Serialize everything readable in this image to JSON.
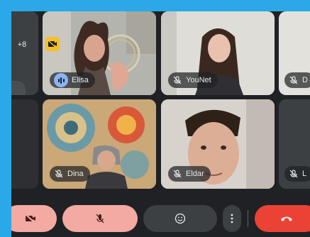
{
  "overflow_count": "+8",
  "participants": [
    {
      "name": "Elisa",
      "state": "speaking"
    },
    {
      "name": "YouNet",
      "state": "muted"
    },
    {
      "name": "D",
      "state": "muted"
    },
    {
      "name": "Dina",
      "state": "muted"
    },
    {
      "name": "Eldar",
      "state": "muted"
    },
    {
      "name": "L",
      "state": "muted"
    }
  ],
  "controls": [
    "camera-off-icon",
    "mic-off-icon",
    "emoji-icon",
    "more-vertical-icon",
    "end-call-icon"
  ],
  "colors": {
    "frame": "#2aa8e7",
    "background": "#202124",
    "accent": "#8ab4f8",
    "off_button": "#f0a8a0",
    "end_call": "#ea4335"
  }
}
